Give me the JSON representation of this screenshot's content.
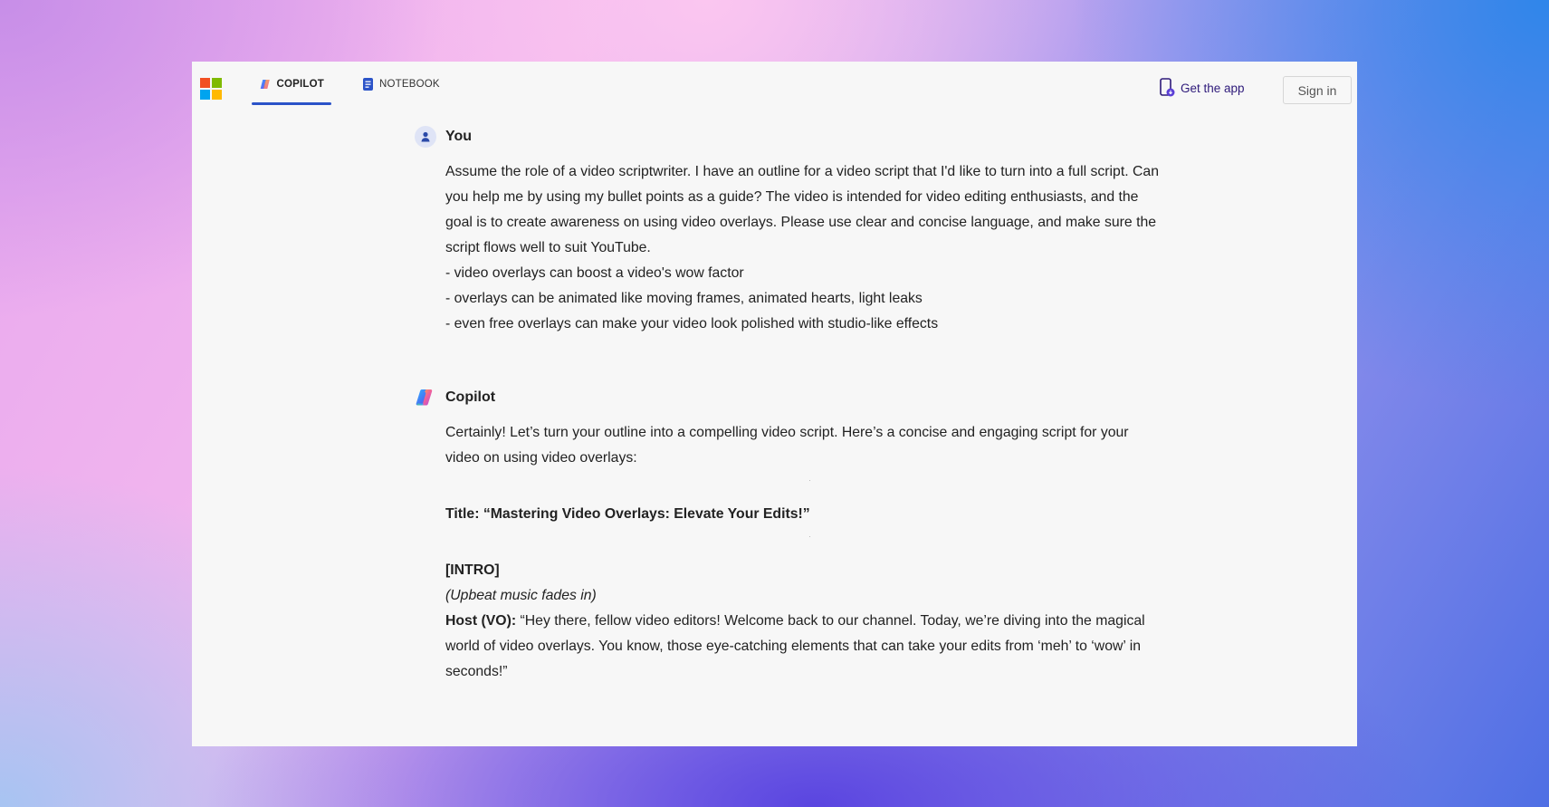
{
  "nav": {
    "tabs": [
      {
        "label": "COPILOT",
        "icon": "copilot-icon",
        "active": true
      },
      {
        "label": "NOTEBOOK",
        "icon": "notebook-icon",
        "active": false
      }
    ],
    "get_app_label": "Get the app",
    "sign_in_label": "Sign in"
  },
  "colors": {
    "accent": "#2b53c8",
    "get_app_text": "#2e1a7a",
    "window_bg": "#f7f7f7"
  },
  "conversation": {
    "user": {
      "name": "You",
      "prompt": "Assume the role of a video scriptwriter. I have an outline for a video script that I'd like to turn into a full script. Can you help me by using my bullet points as a guide? The video is intended for video editing enthusiasts, and the goal is to create awareness on using video overlays. Please use clear and concise language, and make sure the script flows well to suit YouTube.",
      "bullets": [
        "- video overlays can boost a video's wow factor",
        "- overlays can be animated like moving frames, animated hearts, light leaks",
        "- even free overlays can make your video look polished with studio-like effects"
      ]
    },
    "copilot": {
      "name": "Copilot",
      "intro": "Certainly! Let’s turn your outline into a compelling video script. Here’s a concise and engaging script for your video on using video overlays:",
      "title_line": "Title: “Mastering Video Overlays: Elevate Your Edits!”",
      "section_intro": "[INTRO]",
      "stage_direction": "(Upbeat music fades in)",
      "host_label": "Host (VO):",
      "host_line": " “Hey there, fellow video editors! Welcome back to our channel. Today, we’re diving into the magical world of video overlays. You know, those eye-catching elements that can take your edits from ‘meh’ to ‘wow’ in seconds!”"
    }
  }
}
